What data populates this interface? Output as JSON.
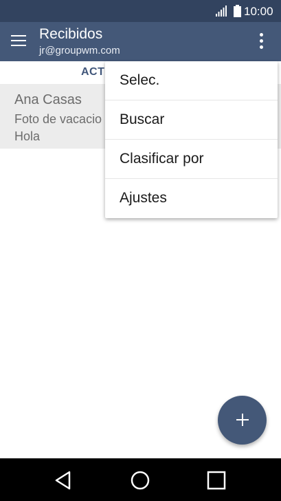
{
  "status_bar": {
    "time": "10:00"
  },
  "app_bar": {
    "title": "Recibidos",
    "account": "jr@groupwm.com"
  },
  "tabs": {
    "active_label": "ACT"
  },
  "mail_items": [
    {
      "sender": "Ana Casas",
      "subject": "Foto de vacacio",
      "preview": "Hola"
    }
  ],
  "overflow_menu": {
    "items": [
      "Selec.",
      "Buscar",
      "Clasificar por",
      "Ajustes"
    ]
  },
  "icons": {
    "menu": "hamburger-menu-icon",
    "overflow": "more-vertical-icon",
    "fab": "plus-icon",
    "back": "back-triangle-icon",
    "home": "home-circle-icon",
    "recent": "recent-apps-square-icon",
    "signal": "signal-icon",
    "battery": "battery-icon"
  },
  "colors": {
    "status_bar": "#32435f",
    "app_bar": "#445878",
    "accent": "#445878",
    "nav_bar": "#000000"
  }
}
